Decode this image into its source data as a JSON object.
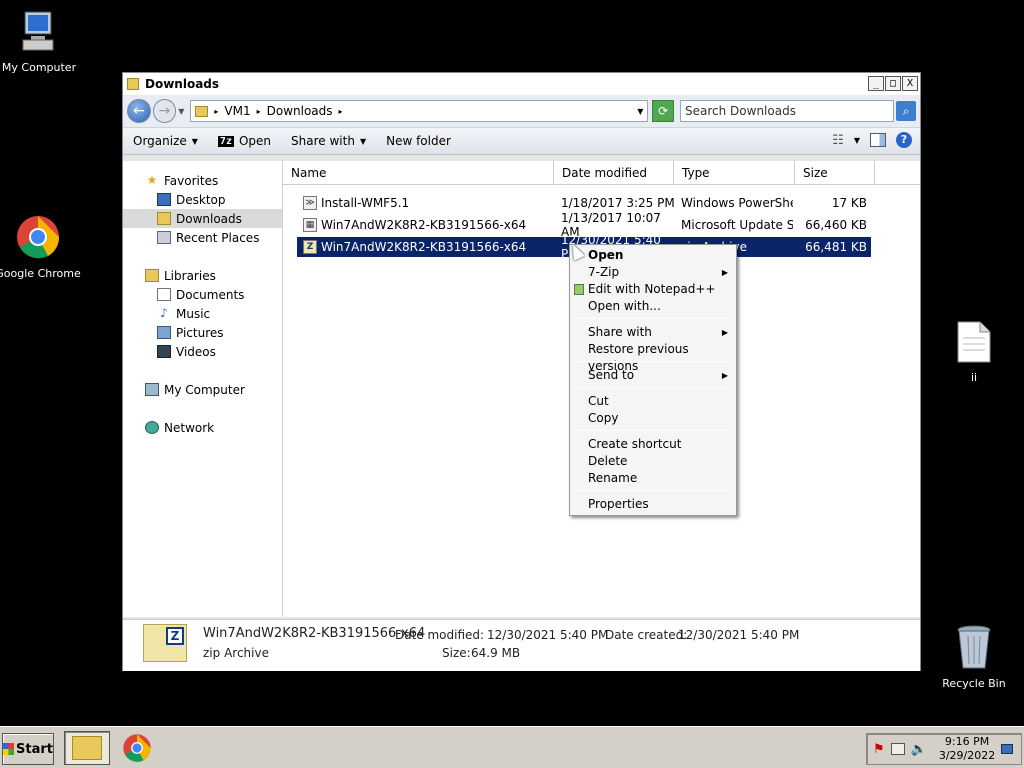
{
  "desktop": {
    "icons": [
      {
        "label": "My Computer"
      },
      {
        "label": "Google Chrome"
      },
      {
        "label": "ii"
      },
      {
        "label": "Recycle Bin"
      }
    ]
  },
  "window": {
    "title": "Downloads",
    "controls": {
      "minimize": "_",
      "maximize": "□",
      "close": "X"
    }
  },
  "address": {
    "crumbs": [
      "VM1",
      "Downloads"
    ],
    "search_placeholder": "Search Downloads"
  },
  "toolbar": {
    "organize": "Organize",
    "open": "Open",
    "share_with": "Share with",
    "new_folder": "New folder"
  },
  "nav": {
    "favorites": "Favorites",
    "desktop": "Desktop",
    "downloads": "Downloads",
    "recent_places": "Recent Places",
    "libraries": "Libraries",
    "documents": "Documents",
    "music": "Music",
    "pictures": "Pictures",
    "videos": "Videos",
    "my_computer": "My Computer",
    "network": "Network"
  },
  "columns": {
    "name": "Name",
    "date_modified": "Date modified",
    "type": "Type",
    "size": "Size"
  },
  "files": [
    {
      "name": "Install-WMF5.1",
      "date": "1/18/2017 3:25 PM",
      "type": "Windows PowerShel...",
      "size": "17 KB"
    },
    {
      "name": "Win7AndW2K8R2-KB3191566-x64",
      "date": "1/13/2017 10:07 AM",
      "type": "Microsoft Update St...",
      "size": "66,460 KB"
    },
    {
      "name": "Win7AndW2K8R2-KB3191566-x64",
      "date": "12/30/2021 5:40 PM",
      "type": "zip Archive",
      "size": "66,481 KB"
    }
  ],
  "context_menu": {
    "open": "Open",
    "seven_zip": "7-Zip",
    "edit_notepad": "Edit with Notepad++",
    "open_with": "Open with...",
    "share_with": "Share with",
    "restore": "Restore previous versions",
    "send_to": "Send to",
    "cut": "Cut",
    "copy": "Copy",
    "create_shortcut": "Create shortcut",
    "delete": "Delete",
    "rename": "Rename",
    "properties": "Properties"
  },
  "details": {
    "name": "Win7AndW2K8R2-KB3191566-x64",
    "type": "zip Archive",
    "date_modified_label": "Date modified:",
    "date_modified": "12/30/2021 5:40 PM",
    "date_created_label": "Date created:",
    "date_created": "12/30/2021 5:40 PM",
    "size_label": "Size:",
    "size": "64.9 MB"
  },
  "taskbar": {
    "start": "Start",
    "time": "9:16 PM",
    "date": "3/29/2022"
  }
}
